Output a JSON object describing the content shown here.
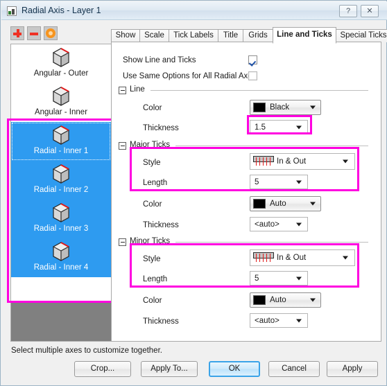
{
  "window": {
    "title": "Radial Axis - Layer 1",
    "help_label": "?",
    "close_label": "✕"
  },
  "toolbar": {
    "add_label": "",
    "delete_label": "",
    "options_label": ""
  },
  "axis_list": {
    "items": [
      {
        "label": "Angular - Outer",
        "selected": false
      },
      {
        "label": "Angular - Inner",
        "selected": false
      },
      {
        "label": "Radial - Inner 1",
        "selected": true
      },
      {
        "label": "Radial - Inner 2",
        "selected": true
      },
      {
        "label": "Radial - Inner 3",
        "selected": true
      },
      {
        "label": "Radial - Inner 4",
        "selected": true
      }
    ]
  },
  "tabs": [
    {
      "label": "Show",
      "active": false
    },
    {
      "label": "Scale",
      "active": false
    },
    {
      "label": "Tick Labels",
      "active": false
    },
    {
      "label": "Title",
      "active": false
    },
    {
      "label": "Grids",
      "active": false
    },
    {
      "label": "Line and Ticks",
      "active": true
    },
    {
      "label": "Special Ticks",
      "active": false
    }
  ],
  "panel": {
    "show_line_and_ticks": {
      "label": "Show Line and Ticks",
      "checked": true
    },
    "use_same_options": {
      "label": "Use Same Options for All Radial Axes",
      "checked": false
    },
    "groups": [
      {
        "title": "Line",
        "rows": [
          {
            "label": "Color",
            "value": "Black",
            "kind": "color"
          },
          {
            "label": "Thickness",
            "value": "1.5",
            "kind": "text"
          }
        ]
      },
      {
        "title": "Major Ticks",
        "rows": [
          {
            "label": "Style",
            "value": "In & Out",
            "kind": "tickstyle"
          },
          {
            "label": "Length",
            "value": "5",
            "kind": "text"
          },
          {
            "label": "Color",
            "value": "Auto",
            "kind": "color"
          },
          {
            "label": "Thickness",
            "value": "<auto>",
            "kind": "text"
          }
        ]
      },
      {
        "title": "Minor Ticks",
        "rows": [
          {
            "label": "Style",
            "value": "In & Out",
            "kind": "tickstyle"
          },
          {
            "label": "Length",
            "value": "5",
            "kind": "text"
          },
          {
            "label": "Color",
            "value": "Auto",
            "kind": "color"
          },
          {
            "label": "Thickness",
            "value": "<auto>",
            "kind": "text"
          }
        ]
      }
    ]
  },
  "footer": {
    "status": "Select multiple axes to customize together.",
    "buttons": {
      "crop": "Crop...",
      "apply_to": "Apply To...",
      "ok": "OK",
      "cancel": "Cancel",
      "apply": "Apply"
    }
  },
  "colors": {
    "accent": "#2e9bf0",
    "annotation": "#ff00e0",
    "line_color_swatch": "#000000",
    "tick_mark": "#e01b1b"
  }
}
